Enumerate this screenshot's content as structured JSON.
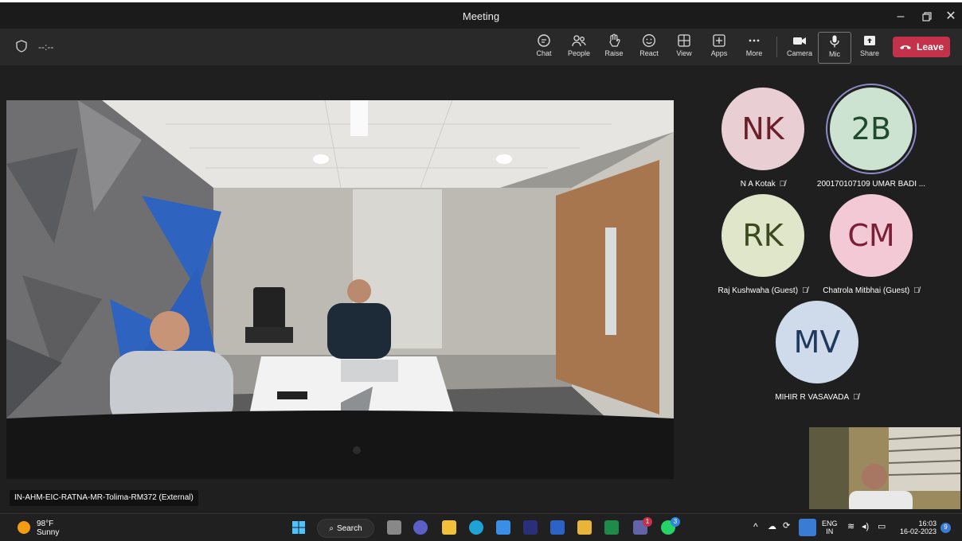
{
  "window": {
    "title": "Meeting"
  },
  "toolbar": {
    "timer": "--:--",
    "buttons": {
      "chat": "Chat",
      "people": "People",
      "raise": "Raise",
      "react": "React",
      "view": "View",
      "apps": "Apps",
      "more": "More",
      "camera": "Camera",
      "mic": "Mic",
      "share": "Share"
    },
    "leave": "Leave"
  },
  "stage": {
    "room_label": "IN-AHM-EIC-RATNA-MR-Tolima-RM372 (External)"
  },
  "participants": [
    {
      "initials": "NK",
      "name": "N A Kotak",
      "bg": "#e9cfd3",
      "fg": "#6b1f2b"
    },
    {
      "initials": "2B",
      "name": "200170107109 UMAR BADI ...",
      "bg": "#cde3d2",
      "fg": "#1e4a2d"
    },
    {
      "initials": "RK",
      "name": "Raj Kushwaha (Guest)",
      "bg": "#dfe6c9",
      "fg": "#3d4a1e"
    },
    {
      "initials": "CM",
      "name": "Chatrola Mitbhai (Guest)",
      "bg": "#f2c9d4",
      "fg": "#7a1f38"
    },
    {
      "initials": "MV",
      "name": "MIHIR R VASAVADA",
      "bg": "#cfdbea",
      "fg": "#1f3a5e"
    }
  ],
  "taskbar": {
    "weather_temp": "98°F",
    "weather_desc": "Sunny",
    "search": "Search",
    "lang_1": "ENG",
    "lang_2": "IN",
    "time": "16:03",
    "date": "16-02-2023",
    "notifications": "9",
    "teams_badge": "1",
    "whatsapp_badge": "3"
  },
  "colors": {
    "leave": "#c4314b",
    "accent": "#8b8cc7"
  }
}
